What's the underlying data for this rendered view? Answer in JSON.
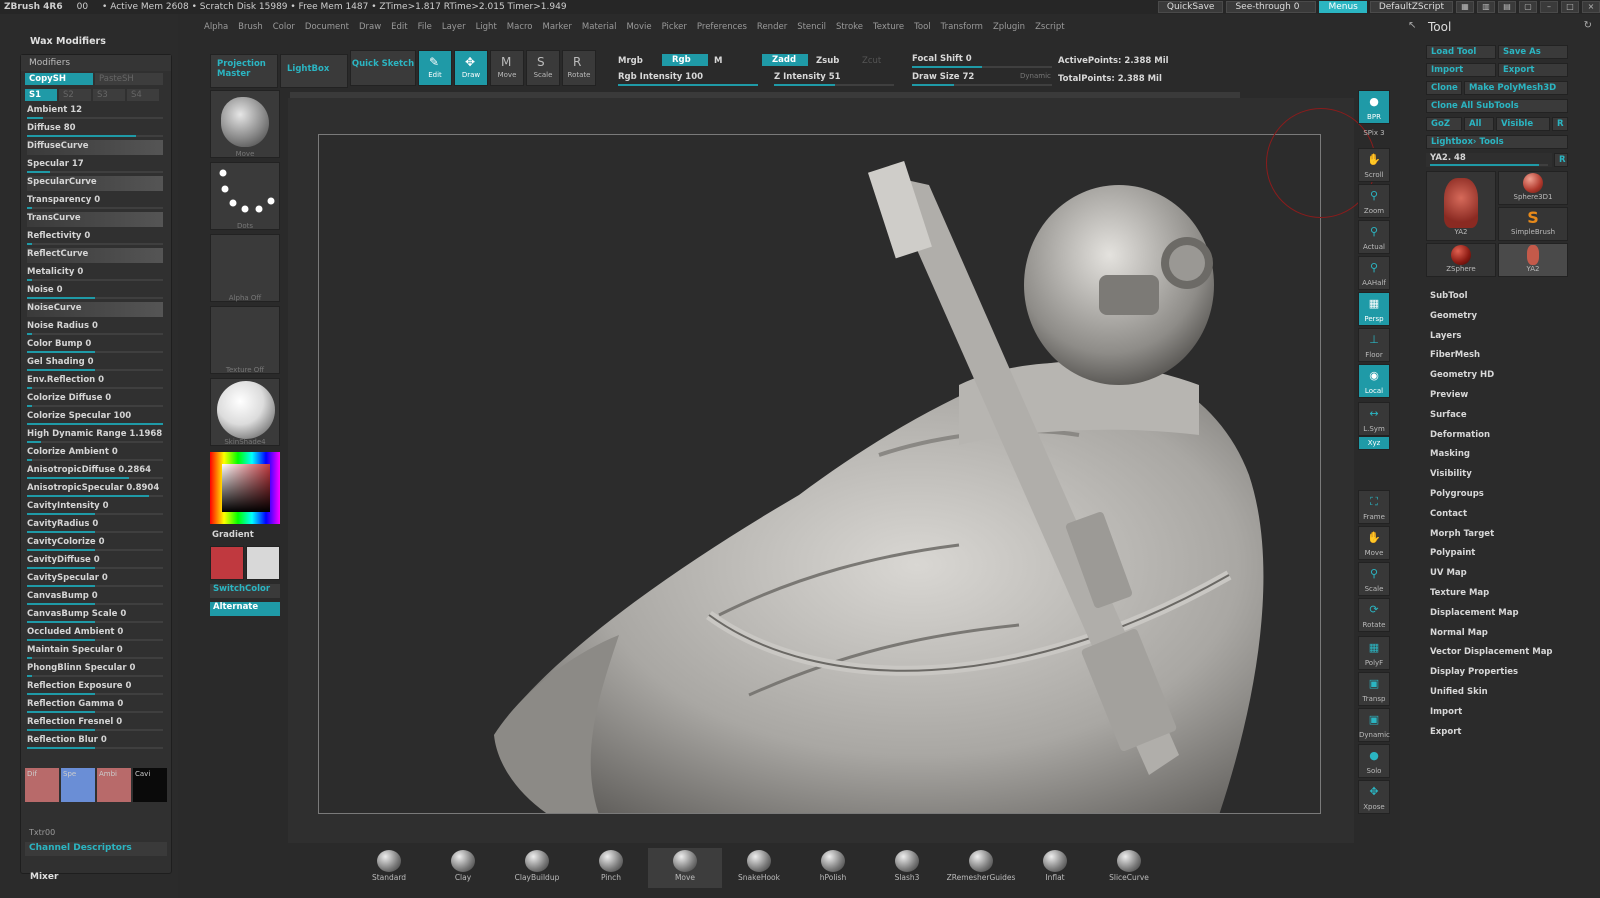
{
  "titlebar": {
    "app": "ZBrush 4R6",
    "value_00": "00",
    "mem": "• Active Mem 2608 • Scratch Disk 15989 • Free Mem 1487 • ZTime>1.817 RTime>2.015 Timer>1.949",
    "quicksave": "QuickSave",
    "seethrough": "See-through  0",
    "menus": "Menus",
    "script": "DefaultZScript"
  },
  "menus": [
    "Alpha",
    "Brush",
    "Color",
    "Document",
    "Draw",
    "Edit",
    "File",
    "Layer",
    "Light",
    "Macro",
    "Marker",
    "Material",
    "Movie",
    "Picker",
    "Preferences",
    "Render",
    "Stencil",
    "Stroke",
    "Texture",
    "Tool",
    "Transform",
    "Zplugin",
    "Zscript"
  ],
  "left_panel": {
    "title": "Wax Modifiers",
    "section": "Modifiers",
    "copy": "CopySH",
    "paste": "PasteSH",
    "slots": [
      "S1",
      "S2",
      "S3",
      "S4"
    ],
    "sliders": [
      {
        "label": "Ambient 12",
        "fill": 0.12
      },
      {
        "label": "Diffuse 80",
        "fill": 0.8
      },
      {
        "label": "DiffuseCurve",
        "curve": true
      },
      {
        "label": "Specular 17",
        "fill": 0.17
      },
      {
        "label": "SpecularCurve",
        "curve": true
      },
      {
        "label": "Transparency 0",
        "fill": 0.0
      },
      {
        "label": "TransCurve",
        "curve": true
      },
      {
        "label": "Reflectivity 0",
        "fill": 0.0
      },
      {
        "label": "ReflectCurve",
        "curve": true
      },
      {
        "label": "Metalicity 0",
        "fill": 0.0
      },
      {
        "label": "Noise 0",
        "fill": 0.5
      },
      {
        "label": "NoiseCurve",
        "curve": true
      },
      {
        "label": "Noise Radius 0",
        "fill": 0.0
      },
      {
        "label": "Color Bump 0",
        "fill": 0.5
      },
      {
        "label": "Gel Shading 0",
        "fill": 0.5
      },
      {
        "label": "Env.Reflection 0",
        "fill": 0.0
      },
      {
        "label": "Colorize Diffuse 0",
        "fill": 0.0
      },
      {
        "label": "Colorize Specular 100",
        "fill": 1.0
      },
      {
        "label": "High Dynamic Range 1.1968",
        "fill": 0.1
      },
      {
        "label": "Colorize Ambient 0",
        "fill": 0.0
      },
      {
        "label": "AnisotropicDiffuse 0.2864",
        "fill": 0.75
      },
      {
        "label": "AnisotropicSpecular 0.8904",
        "fill": 0.9
      },
      {
        "label": "CavityIntensity 0",
        "fill": 0.5
      },
      {
        "label": "CavityRadius 0",
        "fill": 0.5
      },
      {
        "label": "CavityColorize 0",
        "fill": 0.5
      },
      {
        "label": "CavityDiffuse 0",
        "fill": 0.5
      },
      {
        "label": "CavitySpecular 0",
        "fill": 0.5
      },
      {
        "label": "CanvasBump 0",
        "fill": 0.5
      },
      {
        "label": "CanvasBump Scale 0",
        "fill": 0.5
      },
      {
        "label": "Occluded  Ambient 0",
        "fill": 0.5
      },
      {
        "label": "Maintain Specular 0",
        "fill": 0.0
      },
      {
        "label": "PhongBlinn Specular 0",
        "fill": 0.0
      },
      {
        "label": "Reflection Exposure 0",
        "fill": 0.5
      },
      {
        "label": "Reflection Gamma 0",
        "fill": 0.5
      },
      {
        "label": "Reflection Fresnel 0",
        "fill": 0.5
      },
      {
        "label": "Reflection Blur 0",
        "fill": 0.5
      }
    ],
    "swatches": [
      {
        "label": "Dif",
        "color": "#b86a6a"
      },
      {
        "label": "Spe",
        "color": "#6a8ed6"
      },
      {
        "label": "Ambi",
        "color": "#b86a6a"
      },
      {
        "label": "Cavi",
        "color": "#0a0a0a"
      }
    ],
    "txtr": "Txtr00",
    "channel": "Channel Descriptors",
    "mixer": "Mixer"
  },
  "tool_column": {
    "projection": "Projection Master",
    "lightbox": "LightBox",
    "tiles": [
      {
        "label": "Move"
      },
      {
        "label": "Dots"
      },
      {
        "label": "Alpha  Off"
      },
      {
        "label": "Texture  Off"
      },
      {
        "label": "SkinShade4"
      }
    ],
    "gradient": "Gradient",
    "switchcolor": "SwitchColor",
    "alternate": "Alternate",
    "main_color": "#c0393f",
    "secondary_color": "#d8d8d8"
  },
  "toolbar": {
    "quick_sketch": "Quick Sketch",
    "tools": [
      {
        "label": "Edit",
        "icon": "edit-icon",
        "glyph": "✎",
        "active": true
      },
      {
        "label": "Draw",
        "icon": "draw-icon",
        "glyph": "✥",
        "active": true
      },
      {
        "label": "Move",
        "icon": "move-icon",
        "glyph": "M",
        "active": false
      },
      {
        "label": "Scale",
        "icon": "scale-icon",
        "glyph": "S",
        "active": false
      },
      {
        "label": "Rotate",
        "icon": "rotate-icon",
        "glyph": "R",
        "active": false
      }
    ],
    "mrgb": "Mrgb",
    "rgb": "Rgb",
    "m": "M",
    "rgb_intensity": "Rgb  Intensity 100",
    "zadd": "Zadd",
    "zsub": "Zsub",
    "zcut": "Zcut",
    "z_intensity": "Z  Intensity 51",
    "focal_shift": "Focal  Shift 0",
    "draw_size": "Draw  Size 72",
    "dynamic": "Dynamic",
    "active_points": "ActivePoints: 2.388  Mil",
    "total_points": "TotalPoints: 2.388  Mil"
  },
  "brushes": [
    {
      "label": "Standard"
    },
    {
      "label": "Clay"
    },
    {
      "label": "ClayBuildup"
    },
    {
      "label": "Pinch"
    },
    {
      "label": "Move",
      "selected": true
    },
    {
      "label": "SnakeHook"
    },
    {
      "label": "hPolish"
    },
    {
      "label": "Slash3"
    },
    {
      "label": "ZRemesherGuides"
    },
    {
      "label": "Inflat"
    },
    {
      "label": "SliceCurve"
    }
  ],
  "nav": [
    {
      "label": "BPR",
      "active": true
    },
    {
      "label": "SPix 3"
    },
    {
      "label": "Scroll"
    },
    {
      "label": "Zoom"
    },
    {
      "label": "Actual"
    },
    {
      "label": "AAHalf"
    },
    {
      "label": "Persp",
      "active": true
    },
    {
      "label": "Floor"
    },
    {
      "label": "Local",
      "active": true
    },
    {
      "label": "L.Sym"
    },
    {
      "label": "Xyz",
      "active": true
    },
    {
      "label": "Frame"
    },
    {
      "label": "Move"
    },
    {
      "label": "Scale"
    },
    {
      "label": "Rotate"
    },
    {
      "label": "PolyF"
    },
    {
      "label": "Transp"
    },
    {
      "label": "Dynamic"
    },
    {
      "label": "Solo"
    },
    {
      "label": "Xpose"
    }
  ],
  "tool_panel": {
    "title": "Tool",
    "buttons": [
      "Load Tool",
      "Save As",
      "Import",
      "Export",
      "Clone",
      "Make PolyMesh3D",
      "Clone  All  SubTools",
      "GoZ",
      "All",
      "Visible",
      "R",
      "Lightbox› Tools"
    ],
    "tool_slider": "YA2. 48",
    "r_button": "R",
    "thumbs": [
      {
        "label": "YA2"
      },
      {
        "label": "Sphere3D1"
      },
      {
        "label": "SimpleBrush"
      },
      {
        "label": "ZSphere"
      },
      {
        "label": "YA2"
      }
    ],
    "menu": [
      "SubTool",
      "Geometry",
      "Layers",
      "FiberMesh",
      "Geometry HD",
      "Preview",
      "Surface",
      "Deformation",
      "Masking",
      "Visibility",
      "Polygroups",
      "Contact",
      "Morph Target",
      "Polypaint",
      "UV Map",
      "Texture Map",
      "Displacement Map",
      "Normal Map",
      "Vector Displacement Map",
      "Display Properties",
      "Unified Skin",
      "Import",
      "Export"
    ]
  }
}
